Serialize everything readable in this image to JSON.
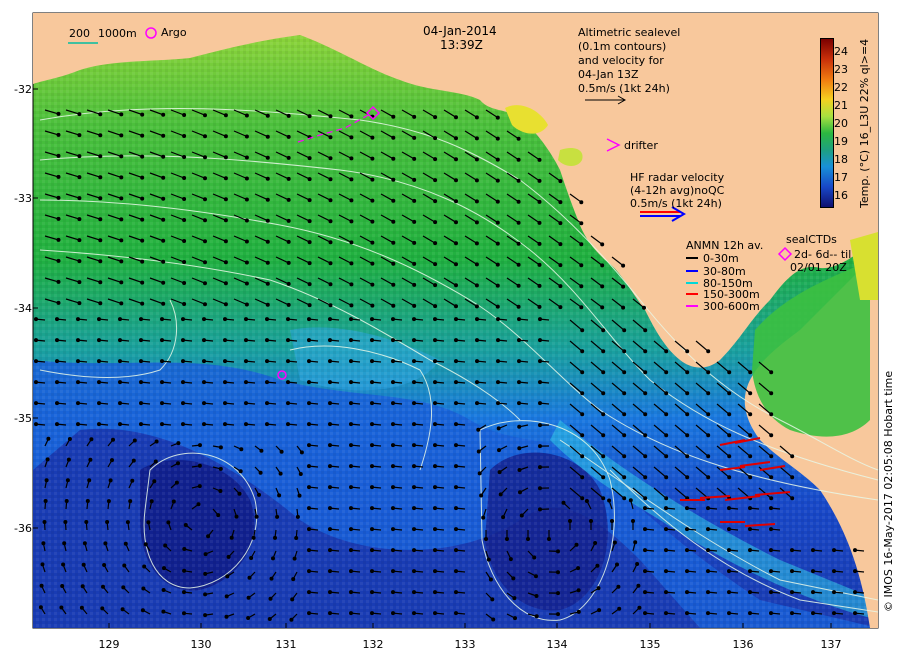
{
  "header": {
    "date": "04-Jan-2014",
    "time": "13:39Z"
  },
  "scale_bar": {
    "label_200": "200",
    "label_1000m": "1000m"
  },
  "argo_label": "Argo",
  "altimetry": {
    "line1": "Altimetric sealevel",
    "line2": "(0.1m contours)",
    "line3": "and velocity for",
    "line4": "04-Jan 13Z",
    "line5": "0.5m/s (1kt 24h)"
  },
  "drifter_label": "drifter",
  "hf_radar": {
    "line1": "HF radar velocity",
    "line2": "(4-12h avg)noQC",
    "line3": "0.5m/s (1kt 24h)"
  },
  "anmn": {
    "title": "ANMN 12h av.",
    "items": [
      {
        "label": "0-30m",
        "color": "#000000"
      },
      {
        "label": "30-80m",
        "color": "#0000ff"
      },
      {
        "label": "80-150m",
        "color": "#00d8d8"
      },
      {
        "label": "150-300m",
        "color": "#ff0000"
      },
      {
        "label": "300-600m",
        "color": "#ff00ff"
      }
    ]
  },
  "seal_ctds": {
    "title": "sealCTDs",
    "line2": "2d- 6d-- til",
    "line3": "02/01 20Z"
  },
  "colorbar": {
    "label": "Temp. (°C) 16_L3U 22% ql>=4",
    "ticks": [
      "24",
      "23",
      "22",
      "21",
      "20",
      "19",
      "18",
      "17",
      "16"
    ]
  },
  "credit": "© IMOS 16-May-2017 02:05:08 Hobart time",
  "axes": {
    "y_ticks": [
      "-32",
      "-33",
      "-34",
      "-35",
      "-36"
    ],
    "x_ticks": [
      "129",
      "130",
      "131",
      "132",
      "133",
      "134",
      "135",
      "136",
      "137"
    ]
  },
  "colors": {
    "land": "#f8c89c",
    "warm": "#2cb840",
    "cool": "#1850d8",
    "deep": "#101888"
  }
}
